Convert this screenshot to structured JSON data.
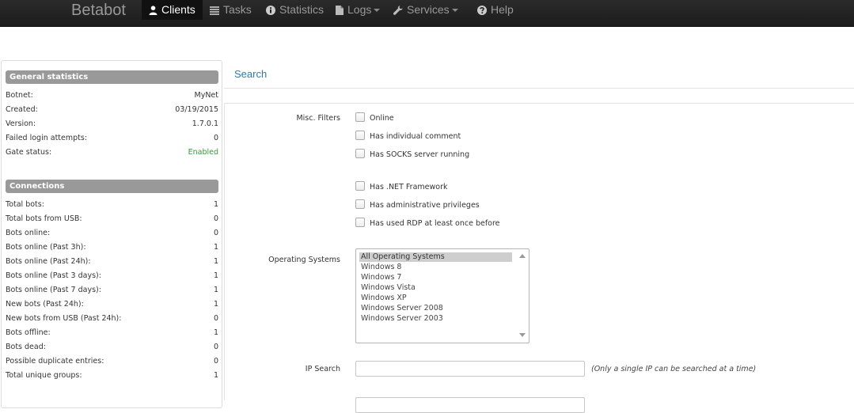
{
  "navbar": {
    "brand": "Betabot",
    "items": [
      {
        "label": "Clients",
        "icon": "user-icon",
        "active": true
      },
      {
        "label": "Tasks",
        "icon": "list-icon"
      },
      {
        "label": "Statistics",
        "icon": "info-icon"
      },
      {
        "label": "Logs",
        "icon": "file-icon",
        "dropdown": true
      },
      {
        "label": "Services",
        "icon": "wrench-icon",
        "dropdown": true
      },
      {
        "label": "Help",
        "icon": "question-icon"
      }
    ]
  },
  "sidebar": {
    "general_title": "General statistics",
    "general": [
      {
        "label": "Botnet:",
        "value": "MyNet"
      },
      {
        "label": "Created:",
        "value": "03/19/2015"
      },
      {
        "label": "Version:",
        "value": "1.7.0.1"
      },
      {
        "label": "Failed login attempts:",
        "value": "0"
      },
      {
        "label": "Gate status:",
        "value": "Enabled",
        "color": "#3a9a3a"
      }
    ],
    "connections_title": "Connections",
    "connections": [
      {
        "label": "Total bots:",
        "value": "1"
      },
      {
        "label": "Total bots from USB:",
        "value": "0"
      },
      {
        "label": "Bots online:",
        "value": "0"
      },
      {
        "label": "Bots online (Past 3h):",
        "value": "1"
      },
      {
        "label": "Bots online (Past 24h):",
        "value": "1"
      },
      {
        "label": "Bots online (Past 3 days):",
        "value": "1"
      },
      {
        "label": "Bots online (Past 7 days):",
        "value": "1"
      },
      {
        "label": "New bots (Past 24h):",
        "value": "1"
      },
      {
        "label": "New bots from USB (Past 24h):",
        "value": "0"
      },
      {
        "label": "Bots offline:",
        "value": "1"
      },
      {
        "label": "Bots dead:",
        "value": "0"
      },
      {
        "label": "Possible duplicate entries:",
        "value": "0"
      },
      {
        "label": "Total unique groups:",
        "value": "1"
      }
    ]
  },
  "main": {
    "title": "Search",
    "misc_label": "Misc. Filters",
    "misc_filters": [
      {
        "label": "Online",
        "checked": false
      },
      {
        "label": "Has individual comment",
        "checked": false
      },
      {
        "label": "Has SOCKS server running",
        "checked": false
      },
      {
        "label": "Has .NET Framework",
        "checked": false
      },
      {
        "label": "Has administrative privileges",
        "checked": false
      },
      {
        "label": "Has used RDP at least once before",
        "checked": false
      }
    ],
    "os_label": "Operating Systems",
    "os_options": [
      {
        "label": "All Operating Systems",
        "selected": true
      },
      {
        "label": "Windows 8"
      },
      {
        "label": "Windows 7"
      },
      {
        "label": "Windows Vista"
      },
      {
        "label": "Windows XP"
      },
      {
        "label": "Windows Server 2008"
      },
      {
        "label": "Windows Server 2003"
      }
    ],
    "ip_label": "IP Search",
    "ip_value": "",
    "ip_hint": "(Only a single IP can be searched at a time)"
  },
  "colors": {
    "navbar_bg": "#1c1c1c",
    "accent": "#2a7ab7",
    "section_header": "#999999",
    "enabled": "#3a9a3a"
  }
}
